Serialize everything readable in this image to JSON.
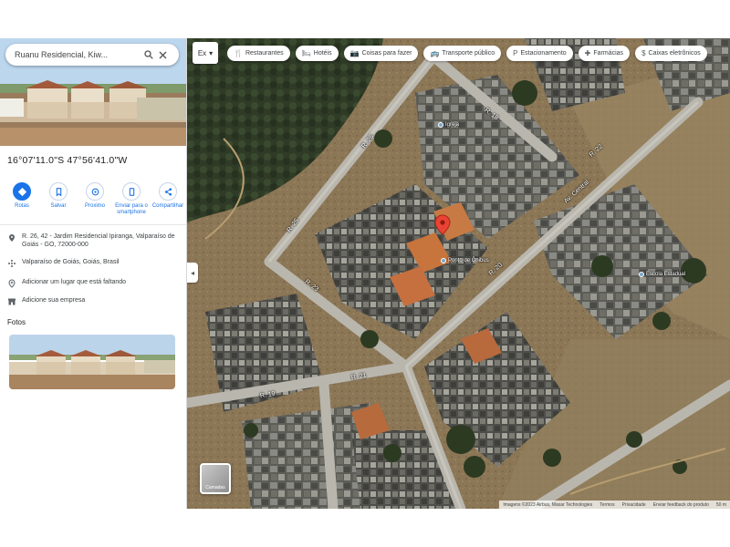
{
  "search": {
    "query": "Ruanu Residencial, Kiw..."
  },
  "coordinates": "16°07'11.0\"S 47°56'41.0\"W",
  "actions": [
    {
      "label": "Rotas",
      "icon": "directions-icon"
    },
    {
      "label": "Salvar",
      "icon": "bookmark-icon"
    },
    {
      "label": "Proximo",
      "icon": "nearby-icon"
    },
    {
      "label": "Enviar para o smartphone",
      "icon": "send-to-phone-icon"
    },
    {
      "label": "Compartilhar",
      "icon": "share-icon"
    }
  ],
  "info": [
    {
      "icon": "location-pin-icon",
      "text": "R. 26, 42 - Jardim Residencial Ipiranga, Valparaíso de Goiás - GO, 72000-000"
    },
    {
      "icon": "plus-code-icon",
      "text": "Valparaíso de Goiás, Goiás, Brasil"
    },
    {
      "icon": "add-place-icon",
      "text": "Adicionar um lugar que está faltando"
    },
    {
      "icon": "business-icon",
      "text": "Adicione sua empresa"
    }
  ],
  "photos_label": "Fotos",
  "map": {
    "layer_control": "Ex",
    "layers_label": "Camadas",
    "chips": [
      {
        "label": "Restaurantes",
        "icon": "restaurant-icon"
      },
      {
        "label": "Hotéis",
        "icon": "hotel-icon"
      },
      {
        "label": "Coisas para fazer",
        "icon": "attractions-icon"
      },
      {
        "label": "Transporte público",
        "icon": "transit-icon"
      },
      {
        "label": "Estacionamento",
        "icon": "parking-icon"
      },
      {
        "label": "Farmácias",
        "icon": "pharmacy-icon"
      },
      {
        "label": "Caixas eletrônicos",
        "icon": "atm-icon"
      }
    ],
    "streets": [
      {
        "name": "R. 26"
      },
      {
        "name": "R. 18"
      },
      {
        "name": "R. 25"
      },
      {
        "name": "R. 23"
      },
      {
        "name": "R. 20"
      },
      {
        "name": "R. 22"
      },
      {
        "name": "R. 21"
      },
      {
        "name": "R. 19"
      },
      {
        "name": "Av. Central"
      }
    ],
    "places": [
      {
        "name": "Ponto de Ônibus"
      },
      {
        "name": "Igreja"
      },
      {
        "name": "Escola Estadual"
      }
    ],
    "attribution": [
      "Imagens ©2023 Airbus, Maxar Technologies",
      "Termos",
      "Privacidade",
      "Enviar feedback do produto"
    ],
    "scale": "50 m"
  },
  "colors": {
    "accent": "#1a73e8",
    "pin": "#ea4335"
  }
}
